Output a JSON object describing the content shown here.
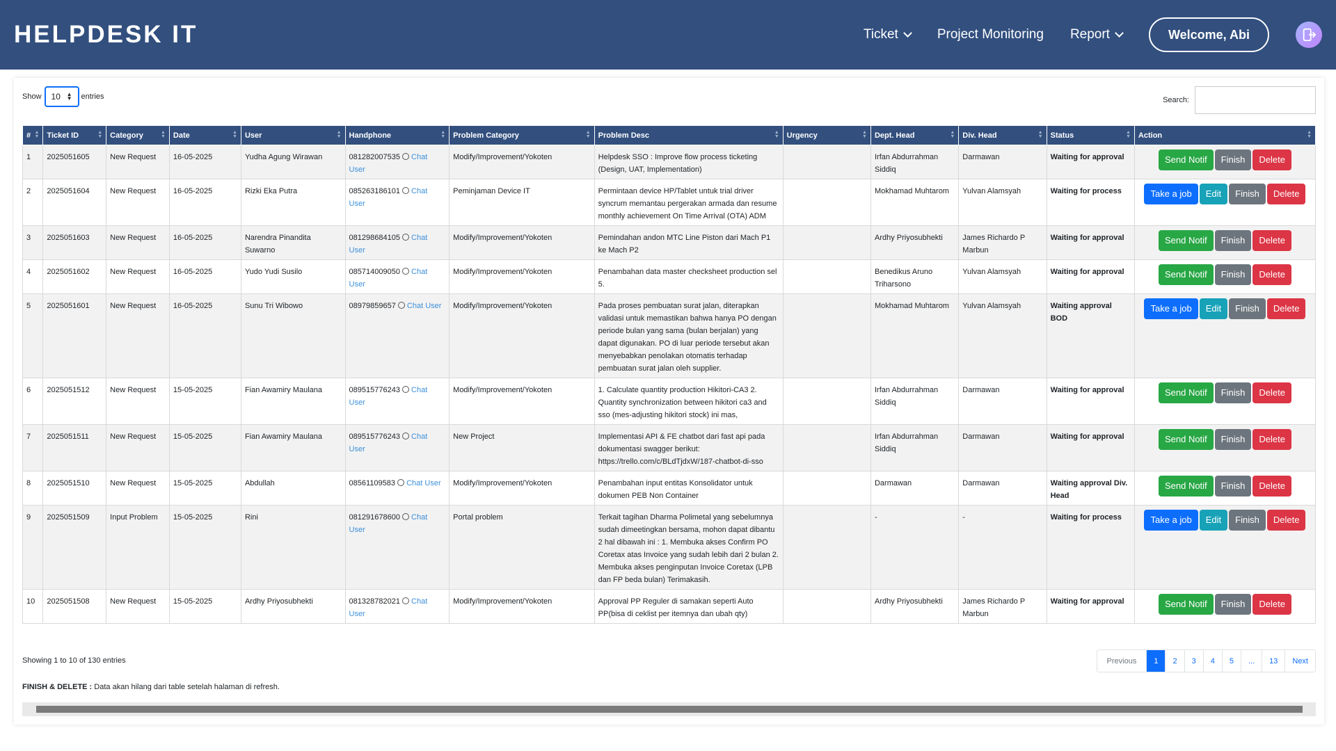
{
  "app": {
    "brand": "HELPDESK IT"
  },
  "nav": {
    "ticket": "Ticket",
    "project_monitoring": "Project Monitoring",
    "report": "Report",
    "welcome": "Welcome, Abi"
  },
  "controls": {
    "show_label": "Show",
    "entries_label": "entries",
    "show_value": "10",
    "search_label": "Search:"
  },
  "table": {
    "headers": [
      "#",
      "Ticket ID",
      "Category",
      "Date",
      "User",
      "Handphone",
      "Problem Category",
      "Problem Desc",
      "Urgency",
      "Dept. Head",
      "Div. Head",
      "Status",
      "Action"
    ],
    "chat_label": "Chat User",
    "rows": [
      {
        "no": "1",
        "ticket_id": "2025051605",
        "category": "New Request",
        "date": "16-05-2025",
        "user": "Yudha Agung Wirawan",
        "handphone": "081282007535",
        "problem_category": "Modify/Improvement/Yokoten",
        "problem_desc": "Helpdesk SSO : Improve flow process ticketing (Design, UAT, Implementation)",
        "urgency": "",
        "dept_head": "Irfan Abdurrahman Siddiq",
        "div_head": "Darmawan",
        "status": "Waiting for approval",
        "actions": [
          "Send Notif",
          "Finish",
          "Delete"
        ]
      },
      {
        "no": "2",
        "ticket_id": "2025051604",
        "category": "New Request",
        "date": "16-05-2025",
        "user": "Rizki Eka Putra",
        "handphone": "085263186101",
        "problem_category": "Peminjaman Device IT",
        "problem_desc": "Permintaan device HP/Tablet untuk trial driver syncrum memantau pergerakan armada dan resume monthly achievement On Time Arrival (OTA) ADM",
        "urgency": "",
        "dept_head": "Mokhamad Muhtarom",
        "div_head": "Yulvan Alamsyah",
        "status": "Waiting for process",
        "actions": [
          "Take a job",
          "Edit",
          "Finish",
          "Delete"
        ]
      },
      {
        "no": "3",
        "ticket_id": "2025051603",
        "category": "New Request",
        "date": "16-05-2025",
        "user": "Narendra Pinandita Suwarno",
        "handphone": "081298684105",
        "problem_category": "Modify/Improvement/Yokoten",
        "problem_desc": "Pemindahan andon MTC Line Piston dari Mach P1 ke Mach P2",
        "urgency": "",
        "dept_head": "Ardhy Priyosubhekti",
        "div_head": "James Richardo P Marbun",
        "status": "Waiting for approval",
        "actions": [
          "Send Notif",
          "Finish",
          "Delete"
        ]
      },
      {
        "no": "4",
        "ticket_id": "2025051602",
        "category": "New Request",
        "date": "16-05-2025",
        "user": "Yudo Yudi Susilo",
        "handphone": "085714009050",
        "problem_category": "Modify/Improvement/Yokoten",
        "problem_desc": "Penambahan data master checksheet production sel 5.",
        "urgency": "",
        "dept_head": "Benedikus Aruno Triharsono",
        "div_head": "Yulvan Alamsyah",
        "status": "Waiting for approval",
        "actions": [
          "Send Notif",
          "Finish",
          "Delete"
        ]
      },
      {
        "no": "5",
        "ticket_id": "2025051601",
        "category": "New Request",
        "date": "16-05-2025",
        "user": "Sunu Tri Wibowo",
        "handphone": "08979859657",
        "problem_category": "Modify/Improvement/Yokoten",
        "problem_desc": "Pada proses pembuatan surat jalan, diterapkan validasi untuk memastikan bahwa hanya PO dengan periode bulan yang sama (bulan berjalan) yang dapat digunakan. PO di luar periode tersebut akan menyebabkan penolakan otomatis terhadap pembuatan surat jalan oleh supplier.",
        "urgency": "",
        "dept_head": "Mokhamad Muhtarom",
        "div_head": "Yulvan Alamsyah",
        "status": "Waiting approval BOD",
        "actions": [
          "Take a job",
          "Edit",
          "Finish",
          "Delete"
        ]
      },
      {
        "no": "6",
        "ticket_id": "2025051512",
        "category": "New Request",
        "date": "15-05-2025",
        "user": "Fian Awamiry Maulana",
        "handphone": "089515776243",
        "problem_category": "Modify/Improvement/Yokoten",
        "problem_desc": "1. Calculate quantity production Hikitori-CA3 2. Quantity synchronization between hikitori ca3 and sso (mes-adjusting hikitori stock) ini mas,",
        "urgency": "",
        "dept_head": "Irfan Abdurrahman Siddiq",
        "div_head": "Darmawan",
        "status": "Waiting for approval",
        "actions": [
          "Send Notif",
          "Finish",
          "Delete"
        ]
      },
      {
        "no": "7",
        "ticket_id": "2025051511",
        "category": "New Request",
        "date": "15-05-2025",
        "user": "Fian Awamiry Maulana",
        "handphone": "089515776243",
        "problem_category": "New Project",
        "problem_desc": "Implementasi API & FE chatbot dari fast api pada dokumentasi swagger berikut: https://trello.com/c/BLdTjdxW/187-chatbot-di-sso",
        "urgency": "",
        "dept_head": "Irfan Abdurrahman Siddiq",
        "div_head": "Darmawan",
        "status": "Waiting for approval",
        "actions": [
          "Send Notif",
          "Finish",
          "Delete"
        ]
      },
      {
        "no": "8",
        "ticket_id": "2025051510",
        "category": "New Request",
        "date": "15-05-2025",
        "user": "Abdullah",
        "handphone": "08561109583",
        "problem_category": "Modify/Improvement/Yokoten",
        "problem_desc": "Penambahan input entitas Konsolidator untuk dokumen PEB Non Container",
        "urgency": "",
        "dept_head": "Darmawan",
        "div_head": "Darmawan",
        "status": "Waiting approval Div. Head",
        "actions": [
          "Send Notif",
          "Finish",
          "Delete"
        ]
      },
      {
        "no": "9",
        "ticket_id": "2025051509",
        "category": "Input Problem",
        "date": "15-05-2025",
        "user": "Rini",
        "handphone": "081291678600",
        "problem_category": "Portal problem",
        "problem_desc": "Terkait tagihan Dharma Polimetal yang sebelumnya sudah dimeetingkan bersama, mohon dapat dibantu 2 hal dibawah ini : 1. Membuka akses Confirm PO Coretax atas Invoice yang sudah lebih dari 2 bulan 2. Membuka akses penginputan Invoice Coretax (LPB dan FP beda bulan) Terimakasih.",
        "urgency": "",
        "dept_head": "-",
        "div_head": "-",
        "status": "Waiting for process",
        "actions": [
          "Take a job",
          "Edit",
          "Finish",
          "Delete"
        ]
      },
      {
        "no": "10",
        "ticket_id": "2025051508",
        "category": "New Request",
        "date": "15-05-2025",
        "user": "Ardhy Priyosubhekti",
        "handphone": "081328782021",
        "problem_category": "Modify/Improvement/Yokoten",
        "problem_desc": "Approval PP Reguler di samakan seperti Auto PP(bisa di ceklist per itemnya dan ubah qty)",
        "urgency": "",
        "dept_head": "Ardhy Priyosubhekti",
        "div_head": "James Richardo P Marbun",
        "status": "Waiting for approval",
        "actions": [
          "Send Notif",
          "Finish",
          "Delete"
        ]
      }
    ]
  },
  "footer": {
    "info": "Showing 1 to 10 of 130 entries",
    "pagination": [
      "Previous",
      "1",
      "2",
      "3",
      "4",
      "5",
      "...",
      "13",
      "Next"
    ],
    "active_page": "1",
    "note_bold": "FINISH & DELETE :",
    "note_text": " Data akan hilang dari table setelah halaman di refresh."
  },
  "colors": {
    "navbar": "#324f7e",
    "send_notif": "#28a745",
    "finish": "#6c757d",
    "delete": "#dc3545",
    "take_job": "#0d6efd",
    "edit": "#17a2b8"
  }
}
